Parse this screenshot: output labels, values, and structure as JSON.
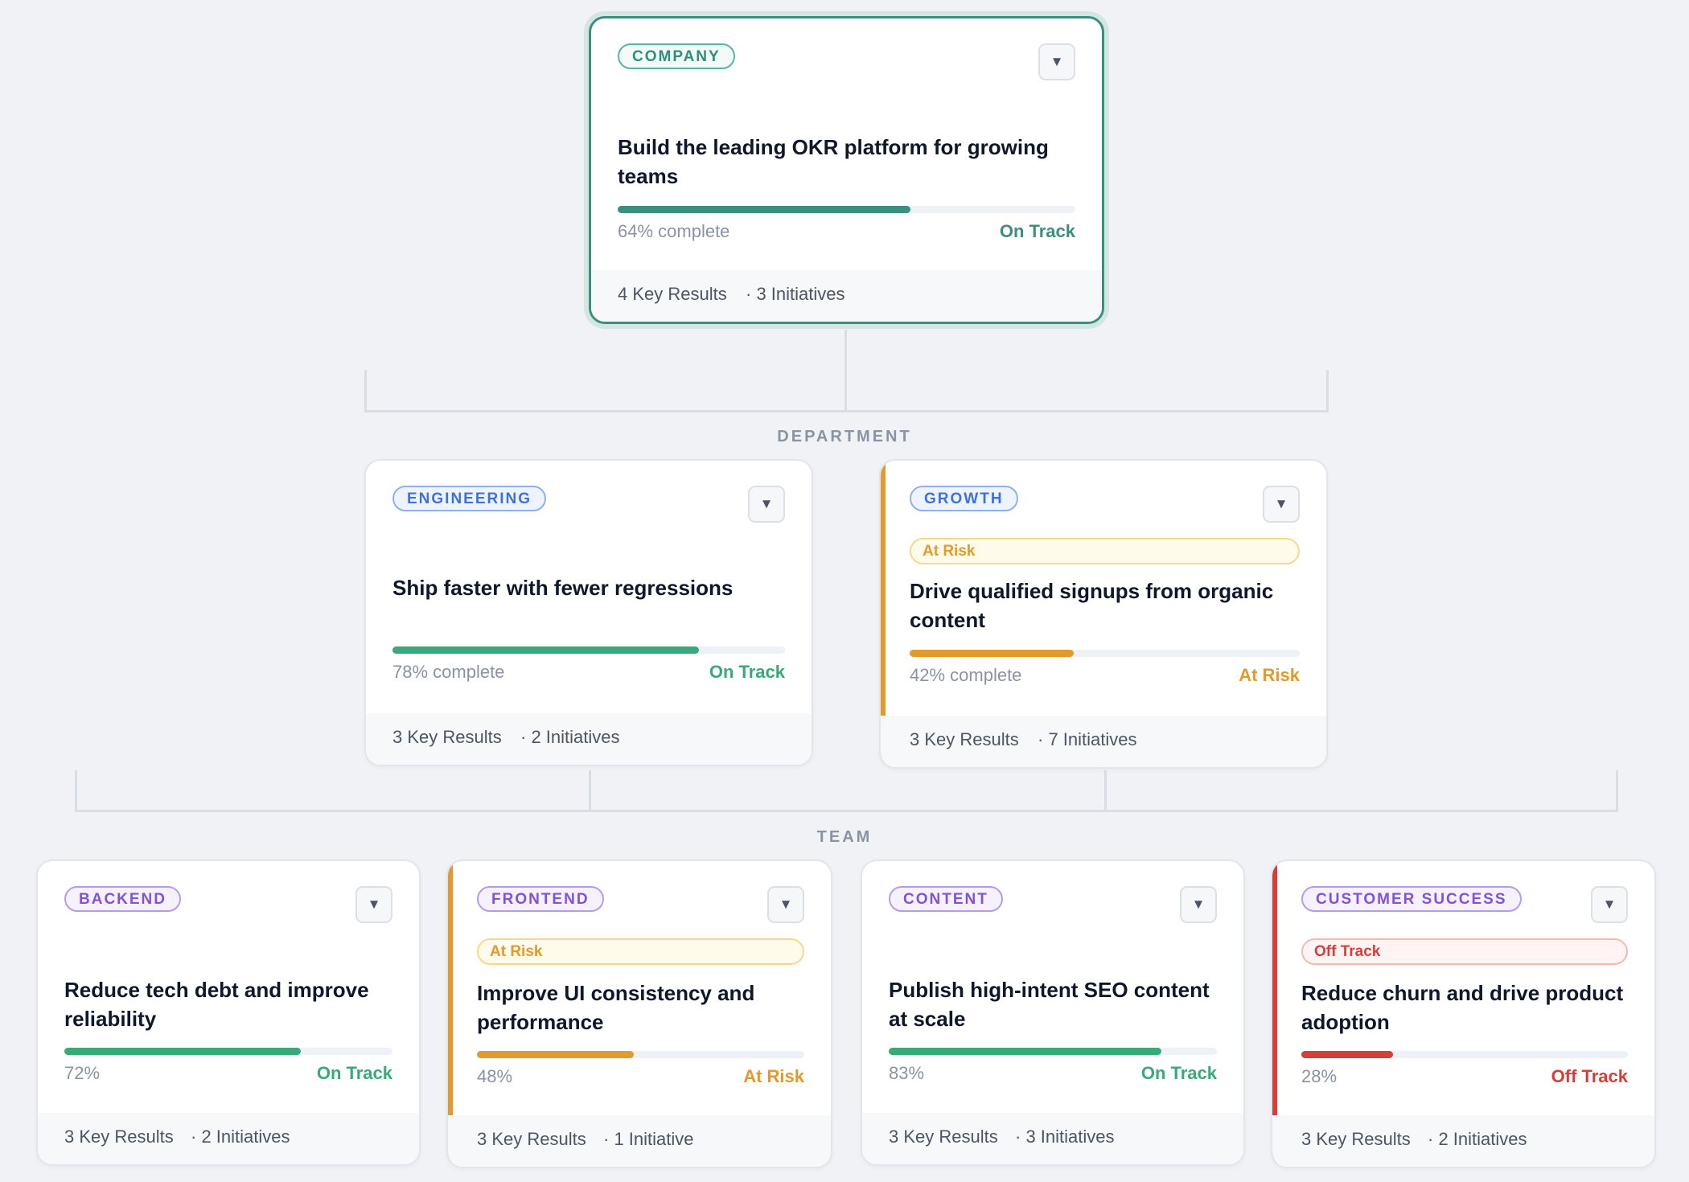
{
  "colors": {
    "on_track": "#3aa97a",
    "on_track_company": "#3a8f7e",
    "at_risk": "#e39a2b",
    "off_track": "#d43f3a",
    "background": "#f0f2f6"
  },
  "levels": {
    "department_label": "DEPARTMENT",
    "team_label": "TEAM"
  },
  "company": {
    "tag": "COMPANY",
    "toggle_icon": "▼",
    "title": "Build the leading OKR platform for growing teams",
    "progress": 64,
    "progress_label": "64% complete",
    "status": "On Track",
    "key_results": "4 Key Results",
    "initiatives": "· 3 Initiatives"
  },
  "departments": [
    {
      "tag": "ENGINEERING",
      "toggle_icon": "▼",
      "title": "Ship faster with fewer regressions",
      "progress": 78,
      "progress_label": "78% complete",
      "status": "On Track",
      "key_results": "3 Key Results",
      "initiatives": "· 2 Initiatives"
    },
    {
      "tag": "GROWTH",
      "toggle_icon": "▼",
      "risk_badge": "At Risk",
      "title": "Drive qualified signups from organic content",
      "progress": 42,
      "progress_label": "42% complete",
      "status": "At Risk",
      "key_results": "3 Key Results",
      "initiatives": "· 7 Initiatives"
    }
  ],
  "teams": [
    {
      "tag": "BACKEND",
      "toggle_icon": "▼",
      "title": "Reduce tech debt and improve reliability",
      "progress": 72,
      "progress_label": "72%",
      "status": "On Track",
      "key_results": "3 Key Results",
      "initiatives": "· 2 Initiatives"
    },
    {
      "tag": "FRONTEND",
      "toggle_icon": "▼",
      "risk_badge": "At Risk",
      "title": "Improve UI consistency and performance",
      "progress": 48,
      "progress_label": "48%",
      "status": "At Risk",
      "key_results": "3 Key Results",
      "initiatives": "· 1 Initiative"
    },
    {
      "tag": "CONTENT",
      "toggle_icon": "▼",
      "title": "Publish high-intent SEO content at scale",
      "progress": 83,
      "progress_label": "83%",
      "status": "On Track",
      "key_results": "3 Key Results",
      "initiatives": "· 3 Initiatives"
    },
    {
      "tag": "CUSTOMER SUCCESS",
      "toggle_icon": "▼",
      "risk_badge": "Off Track",
      "title": "Reduce churn and drive product adoption",
      "progress": 28,
      "progress_label": "28%",
      "status": "Off Track",
      "key_results": "3 Key Results",
      "initiatives": "· 2 Initiatives"
    }
  ]
}
